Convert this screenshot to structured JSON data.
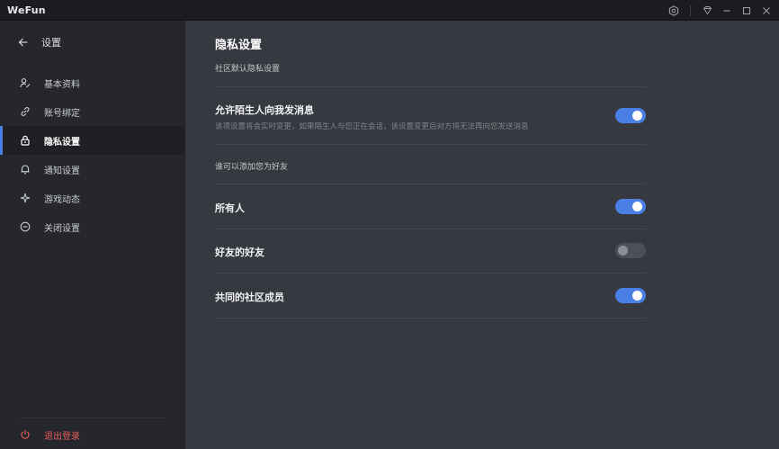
{
  "app": {
    "title": "WeFun"
  },
  "window": {
    "icons": [
      "settings-hex-icon",
      "diamond-icon",
      "minimize-icon",
      "maximize-icon",
      "close-icon"
    ]
  },
  "sidebar": {
    "back_label": "设置",
    "items": [
      {
        "label": "基本资料",
        "icon": "person-edit-icon",
        "active": false
      },
      {
        "label": "账号绑定",
        "icon": "link-icon",
        "active": false
      },
      {
        "label": "隐私设置",
        "icon": "lock-icon",
        "active": true
      },
      {
        "label": "通知设置",
        "icon": "bell-icon",
        "active": false
      },
      {
        "label": "游戏动态",
        "icon": "sparkle-icon",
        "active": false
      },
      {
        "label": "关闭设置",
        "icon": "close-circle-icon",
        "active": false
      }
    ],
    "logout_label": "退出登录"
  },
  "main": {
    "title": "隐私设置",
    "subtitle": "社区默认隐私设置",
    "stranger_msg": {
      "title": "允许陌生人向我发消息",
      "desc": "该项设置将会实时变更，如果陌生人与您正在会话，该设置变更后对方将无法再向您发送消息",
      "enabled": true
    },
    "add_friend_section": "谁可以添加您为好友",
    "options": [
      {
        "label": "所有人",
        "enabled": true
      },
      {
        "label": "好友的好友",
        "enabled": false
      },
      {
        "label": "共同的社区成员",
        "enabled": true
      }
    ]
  },
  "colors": {
    "accent": "#4a7fe6",
    "danger": "#e35b56",
    "sidebar_bg": "#25272c",
    "main_bg": "#36393f"
  }
}
